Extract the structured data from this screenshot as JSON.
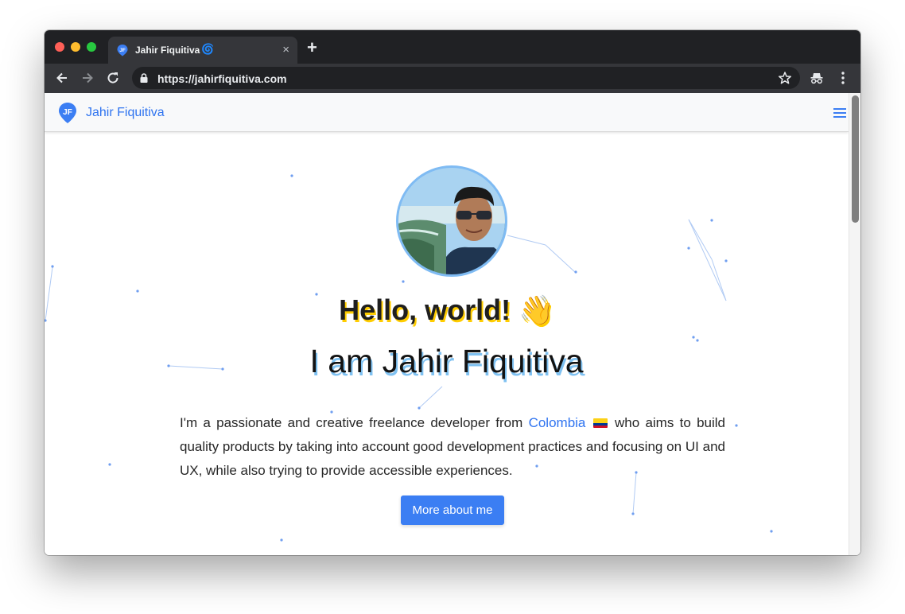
{
  "browser": {
    "tab_title": "Jahir Fiquitiva",
    "tab_emoji": "🌀",
    "tab_close": "×",
    "new_tab": "+",
    "url_scheme": "https://",
    "url_host": "jahirfiquitiva.com"
  },
  "navbar": {
    "brand": "Jahir Fiquitiva"
  },
  "hero": {
    "greeting": "Hello, world! 👋",
    "name": "I am Jahir Fiquitiva",
    "intro_before": "I'm a passionate and creative freelance developer from ",
    "intro_link": "Colombia",
    "intro_after": "  who aims to build quality products by taking into account good development practices and focusing on UI and UX, while also trying to provide accessible experiences.",
    "cta_label": "More about me"
  },
  "colors": {
    "accent": "#3b7ef3",
    "link": "#2f74f0",
    "greeting_shadow": "#ffcd00",
    "name_shadow": "#7fc1f1"
  },
  "icons": {
    "favicon": "jf-pin-icon",
    "back": "arrow-left-icon",
    "forward": "arrow-right-icon",
    "reload": "reload-icon",
    "lock": "lock-icon",
    "star": "star-icon",
    "incognito": "incognito-icon",
    "menu": "vertical-dots-icon",
    "hamburger": "hamburger-icon"
  }
}
